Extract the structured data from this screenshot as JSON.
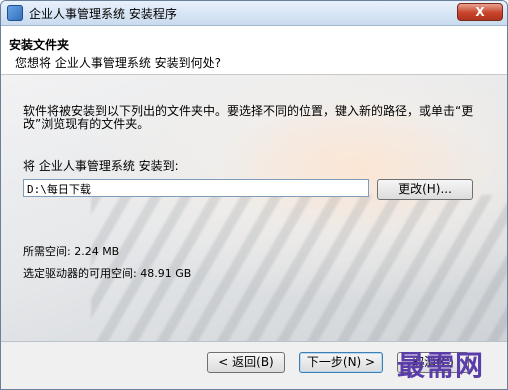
{
  "window": {
    "title": "企业人事管理系统 安装程序",
    "close_symbol": "X"
  },
  "header": {
    "title": "安装文件夹",
    "subtitle": "您想将 企业人事管理系统 安装到何处?"
  },
  "body": {
    "info_text": "软件将被安装到以下列出的文件夹中。要选择不同的位置，键入新的路径，或单击“更改”浏览现有的文件夹。",
    "install_label": "将 企业人事管理系统 安装到:",
    "install_path": "D:\\每日下载",
    "browse_label": "更改(H)...",
    "space_required": "所需空间: 2.24 MB",
    "space_available": "选定驱动器的可用空间: 48.91 GB"
  },
  "footer": {
    "back_label": "< 返回(B)",
    "next_label": "下一步(N) >",
    "cancel_label": "取消(C)"
  },
  "watermark": "最需网"
}
